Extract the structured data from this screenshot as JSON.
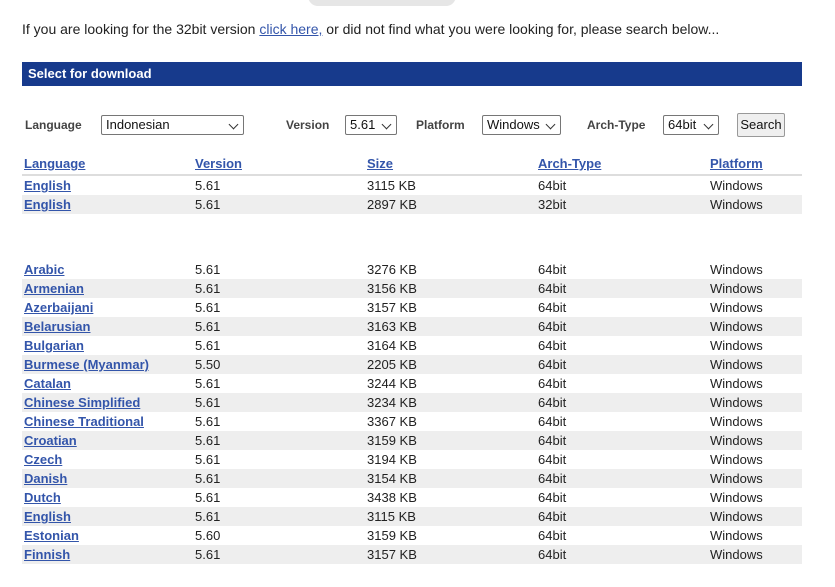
{
  "intro": {
    "prefix": "If you are looking for the 32bit version ",
    "link": "click here,",
    "suffix": " or did not find what you were looking for, please search below..."
  },
  "section_title": "Select for download",
  "filters": {
    "language_label": "Language",
    "language_value": "Indonesian",
    "version_label": "Version",
    "version_value": "5.61",
    "platform_label": "Platform",
    "platform_value": "Windows",
    "arch_label": "Arch-Type",
    "arch_value": "64bit",
    "search_label": "Search"
  },
  "table": {
    "headers": [
      "Language",
      "Version",
      "Size",
      "Arch-Type",
      "Platform"
    ],
    "top_rows": [
      {
        "language": "English",
        "version": "5.61",
        "size": "3115 KB",
        "arch": "64bit",
        "platform": "Windows"
      },
      {
        "language": "English",
        "version": "5.61",
        "size": "2897 KB",
        "arch": "32bit",
        "platform": "Windows"
      }
    ],
    "rows": [
      {
        "language": "Arabic",
        "version": "5.61",
        "size": "3276 KB",
        "arch": "64bit",
        "platform": "Windows"
      },
      {
        "language": "Armenian",
        "version": "5.61",
        "size": "3156 KB",
        "arch": "64bit",
        "platform": "Windows"
      },
      {
        "language": "Azerbaijani",
        "version": "5.61",
        "size": "3157 KB",
        "arch": "64bit",
        "platform": "Windows"
      },
      {
        "language": "Belarusian",
        "version": "5.61",
        "size": "3163 KB",
        "arch": "64bit",
        "platform": "Windows"
      },
      {
        "language": "Bulgarian",
        "version": "5.61",
        "size": "3164 KB",
        "arch": "64bit",
        "platform": "Windows"
      },
      {
        "language": "Burmese (Myanmar)",
        "version": "5.50",
        "size": "2205 KB",
        "arch": "64bit",
        "platform": "Windows"
      },
      {
        "language": "Catalan",
        "version": "5.61",
        "size": "3244 KB",
        "arch": "64bit",
        "platform": "Windows"
      },
      {
        "language": "Chinese Simplified",
        "version": "5.61",
        "size": "3234 KB",
        "arch": "64bit",
        "platform": "Windows"
      },
      {
        "language": "Chinese Traditional",
        "version": "5.61",
        "size": "3367 KB",
        "arch": "64bit",
        "platform": "Windows"
      },
      {
        "language": "Croatian",
        "version": "5.61",
        "size": "3159 KB",
        "arch": "64bit",
        "platform": "Windows"
      },
      {
        "language": "Czech",
        "version": "5.61",
        "size": "3194 KB",
        "arch": "64bit",
        "platform": "Windows"
      },
      {
        "language": "Danish",
        "version": "5.61",
        "size": "3154 KB",
        "arch": "64bit",
        "platform": "Windows"
      },
      {
        "language": "Dutch",
        "version": "5.61",
        "size": "3438 KB",
        "arch": "64bit",
        "platform": "Windows"
      },
      {
        "language": "English",
        "version": "5.61",
        "size": "3115 KB",
        "arch": "64bit",
        "platform": "Windows"
      },
      {
        "language": "Estonian",
        "version": "5.60",
        "size": "3159 KB",
        "arch": "64bit",
        "platform": "Windows"
      },
      {
        "language": "Finnish",
        "version": "5.61",
        "size": "3157 KB",
        "arch": "64bit",
        "platform": "Windows"
      }
    ]
  }
}
